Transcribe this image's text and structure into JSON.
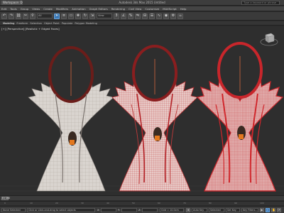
{
  "app": {
    "workspace": "Workspace: Default",
    "title": "Autodesk 3ds Max 2015   Untitled",
    "search_placeholder": "Type a keyword or phrase"
  },
  "menu": [
    "Edit",
    "Tools",
    "Group",
    "Views",
    "Create",
    "Modifiers",
    "Animation",
    "Graph Editors",
    "Rendering",
    "Civil View",
    "Customize",
    "MAXScript",
    "Help"
  ],
  "toolbar": {
    "selection_filter": "All",
    "view_dropdown": "View",
    "icons": [
      "undo-icon",
      "redo-icon",
      "link-icon",
      "unlink-icon",
      "bind-icon",
      "select-icon",
      "select-name-icon",
      "region-icon",
      "move-icon",
      "rotate-icon",
      "scale-icon",
      "snap-icon",
      "angle-snap-icon",
      "percent-snap-icon",
      "mirror-icon",
      "align-icon",
      "layers-icon",
      "curve-editor-icon",
      "material-editor-icon",
      "render-setup-icon",
      "render-icon"
    ]
  },
  "ribbon": {
    "tabs": [
      "Modeling",
      "Freeform",
      "Selection",
      "Object Paint",
      "Populate"
    ],
    "active_tab": "Modeling",
    "sub": "Polygon Modeling"
  },
  "viewport": {
    "label": "[+] [Perspective] [Realistic + Edged Faces]"
  },
  "timeline": {
    "frame": "0 / 100",
    "ticks": [
      "0",
      "10",
      "20",
      "30",
      "40",
      "50",
      "60",
      "70",
      "80",
      "90",
      "100"
    ]
  },
  "status": {
    "selection": "None Selected",
    "prompt": "Click or click-and-drag to select objects",
    "x_label": "X:",
    "y_label": "Y:",
    "z_label": "Z:",
    "grid": "Grid = 10.0cm",
    "auto_key": "Auto Key",
    "selected": "Selected",
    "set_key": "Set Key",
    "key_filters": "Key Filters..."
  }
}
